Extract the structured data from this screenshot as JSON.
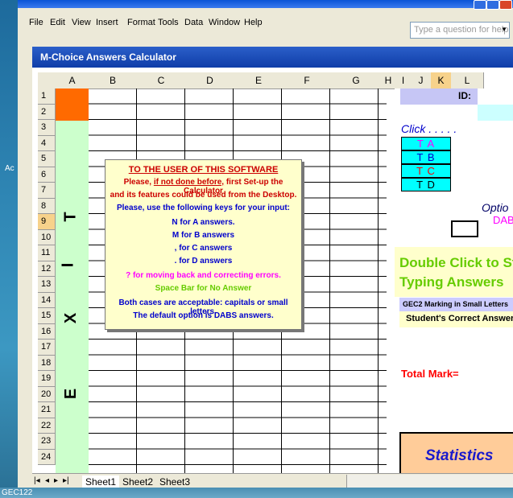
{
  "desktop": {
    "side_label": "Ac",
    "taskbar_label": "GEC122"
  },
  "menubar": {
    "items": [
      "File",
      "Edit",
      "View",
      "Insert",
      "Format",
      "Tools",
      "Data",
      "Window",
      "Help"
    ],
    "question_placeholder": "Type a question for help"
  },
  "workbook": {
    "title": "M-Choice Answers Calculator"
  },
  "columns": [
    "A",
    "B",
    "C",
    "D",
    "E",
    "F",
    "G",
    "H",
    "I",
    "J",
    "K",
    "L"
  ],
  "selected_column": "K",
  "rows": [
    "1",
    "2",
    "3",
    "4",
    "5",
    "6",
    "7",
    "8",
    "9",
    "10",
    "11",
    "12",
    "13",
    "14",
    "15",
    "16",
    "17",
    "18",
    "19",
    "20",
    "21",
    "22",
    "23",
    "24"
  ],
  "selected_row": "9",
  "vertical_text": [
    "T",
    "I",
    "X",
    "E"
  ],
  "notice": {
    "heading": "TO THE USER OF THIS SOFTWARE",
    "line1_pre": "Please, ",
    "line1_link": "if not done before,",
    "line1_post": " first Set-up the Calculator",
    "line2": "and its features  could be used from the Desktop.",
    "line3": "Please, use the following keys for your input:",
    "line4": "N for  A answers.",
    "line5": "M  for  B answers",
    "line6": ",  for  C answers",
    "line7": ".  for  D answers",
    "line8": "?  for moving back and correcting errors.",
    "line9": "Space Bar for No Answer",
    "line10": "Both cases are acceptable: capitals or small letters.",
    "line11": "The default option is DABS answers."
  },
  "panel": {
    "id_label": "ID:",
    "click_label": "Click . . . . .",
    "buttons": [
      "T A",
      "T B",
      "T C",
      "T D"
    ],
    "option_label": "Optio",
    "dabs_label": "DABS",
    "double_click_1": "Double Click to St",
    "double_click_2": "Typing Answers",
    "gec_label": "GEC2 Marking in Small Letters",
    "student_label": "Student's Correct Answer",
    "total_label": "Total Mark=",
    "stats_label": "Statistics"
  },
  "sheets": {
    "tabs": [
      "Sheet1",
      "Sheet2",
      "Sheet3"
    ],
    "active": "Sheet1"
  },
  "colors": {
    "accent_blue": "#0f3da8",
    "orange": "#ff6a00",
    "light_green": "#ccffcc",
    "cyan": "#00ffff"
  }
}
